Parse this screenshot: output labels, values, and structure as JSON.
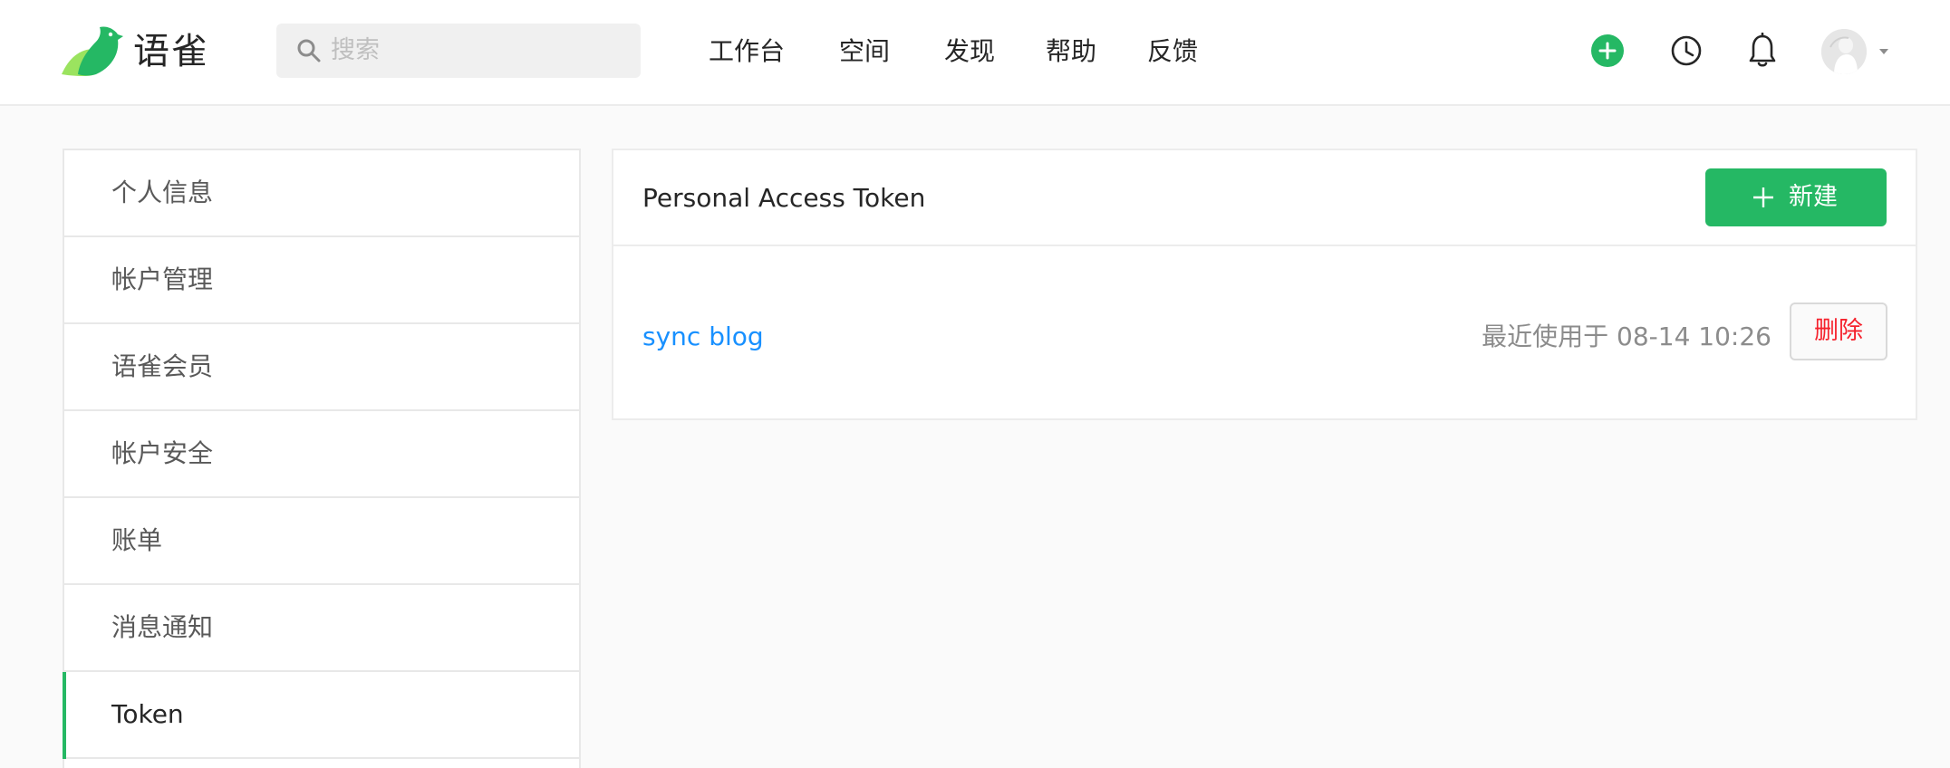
{
  "header": {
    "brand": "语雀",
    "search_placeholder": "搜索",
    "nav": [
      "工作台",
      "空间",
      "发现",
      "帮助",
      "反馈"
    ],
    "icons": {
      "add": "plus-circle-icon",
      "history": "clock-icon",
      "notifications": "bell-icon",
      "avatar": "avatar",
      "menu": "caret-down-icon"
    }
  },
  "sidebar": {
    "items": [
      {
        "label": "个人信息",
        "active": false
      },
      {
        "label": "帐户管理",
        "active": false
      },
      {
        "label": "语雀会员",
        "active": false
      },
      {
        "label": "帐户安全",
        "active": false
      },
      {
        "label": "账单",
        "active": false
      },
      {
        "label": "消息通知",
        "active": false
      },
      {
        "label": "Token",
        "active": true
      }
    ]
  },
  "panel": {
    "title": "Personal Access Token",
    "new_button": "新建",
    "tokens": [
      {
        "name": "sync blog",
        "last_used": "最近使用于 08-14 10:26",
        "delete_label": "删除"
      }
    ]
  },
  "colors": {
    "brand_green": "#25b864",
    "link_blue": "#1890ff",
    "danger_red": "#f5222d"
  }
}
